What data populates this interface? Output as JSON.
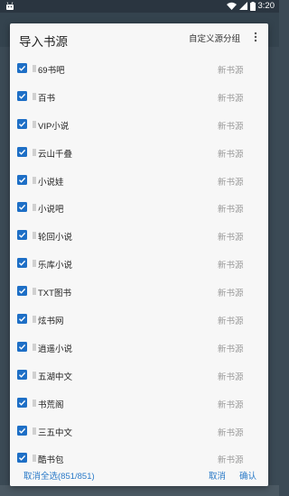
{
  "status_bar": {
    "time": "3:20"
  },
  "dialog": {
    "title": "导入书源",
    "group_button": "自定义源分组",
    "more_icon": "more-vert-icon"
  },
  "colors": {
    "checkbox": "#1e6fc6",
    "action_text": "#2a7ac8",
    "group_text": "#9a9a9a"
  },
  "sources": [
    {
      "name": "69书吧",
      "group": "新书源",
      "checked": true
    },
    {
      "name": "百书",
      "group": "新书源",
      "checked": true
    },
    {
      "name": "VIP小说",
      "group": "新书源",
      "checked": true
    },
    {
      "name": "云山千叠",
      "group": "新书源",
      "checked": true
    },
    {
      "name": "小说娃",
      "group": "新书源",
      "checked": true
    },
    {
      "name": "小说吧",
      "group": "新书源",
      "checked": true
    },
    {
      "name": "轮回小说",
      "group": "新书源",
      "checked": true
    },
    {
      "name": "乐库小说",
      "group": "新书源",
      "checked": true
    },
    {
      "name": "TXT图书",
      "group": "新书源",
      "checked": true
    },
    {
      "name": "炫书网",
      "group": "新书源",
      "checked": true
    },
    {
      "name": "逍遥小说",
      "group": "新书源",
      "checked": true
    },
    {
      "name": "五湖中文",
      "group": "新书源",
      "checked": true
    },
    {
      "name": "书荒阁",
      "group": "新书源",
      "checked": true
    },
    {
      "name": "三五中文",
      "group": "新书源",
      "checked": true
    },
    {
      "name": "酷书包",
      "group": "新书源",
      "checked": true
    }
  ],
  "footer": {
    "select_all": "取消全选(851/851)",
    "cancel": "取消",
    "confirm": "确认"
  }
}
